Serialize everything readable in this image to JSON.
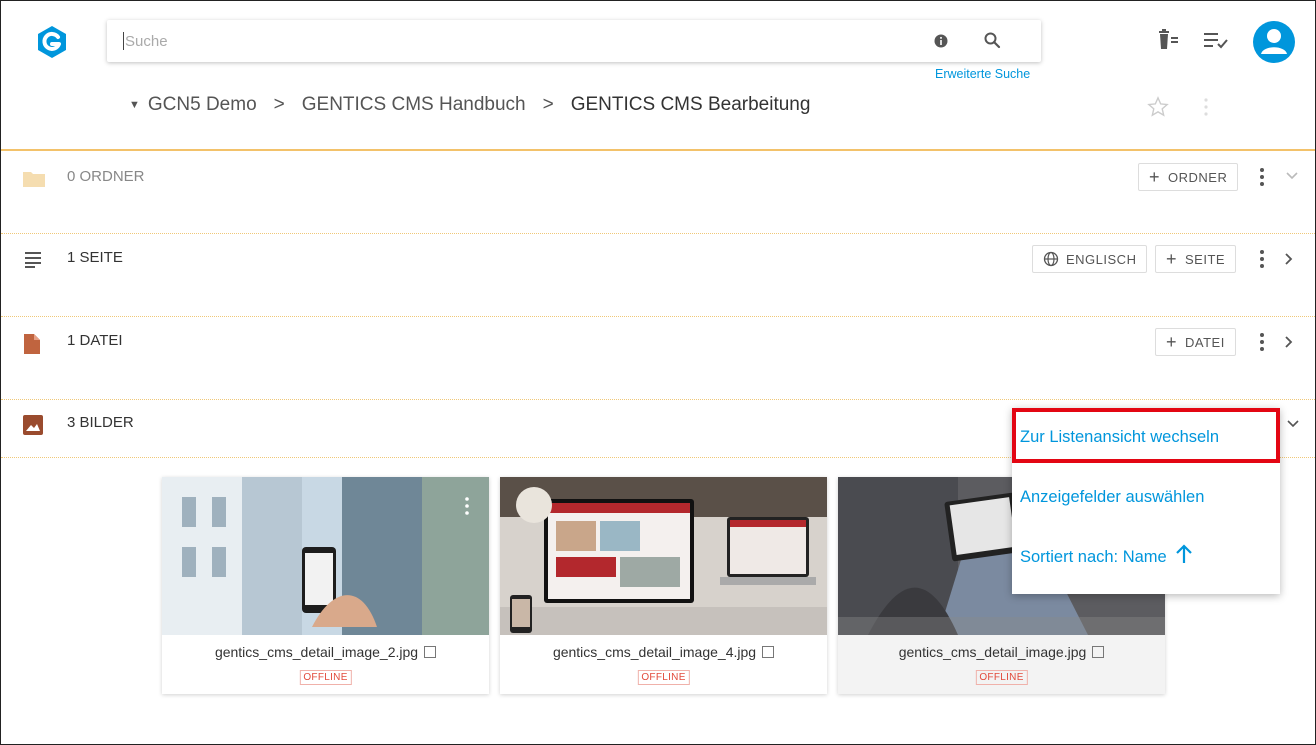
{
  "search": {
    "placeholder": "Suche",
    "advanced_link": "Erweiterte Suche"
  },
  "breadcrumb": {
    "items": [
      "GCN5 Demo",
      "GENTICS CMS Handbuch",
      "GENTICS CMS Bearbeitung"
    ]
  },
  "sections": {
    "folders": {
      "label": "0 ORDNER",
      "add_label": "ORDNER"
    },
    "pages": {
      "label": "1 SEITE",
      "language_label": "ENGLISCH",
      "add_label": "SEITE"
    },
    "files": {
      "label": "1 DATEI",
      "add_label": "DATEI"
    },
    "images": {
      "label": "3 BILDER"
    }
  },
  "images": [
    {
      "filename": "gentics_cms_detail_image_2.jpg",
      "status": "OFFLINE"
    },
    {
      "filename": "gentics_cms_detail_image_4.jpg",
      "status": "OFFLINE"
    },
    {
      "filename": "gentics_cms_detail_image.jpg",
      "status": "OFFLINE"
    }
  ],
  "menu": {
    "items": [
      "Zur Listenansicht wechseln",
      "Anzeigefelder auswählen",
      "Sortiert nach: Name"
    ]
  },
  "colors": {
    "accent": "#0096dc",
    "highlight": "#e30613",
    "divider": "#f3c26a",
    "folder": "#f5ddb0",
    "file": "#c0643f",
    "image": "#9a4b2e"
  }
}
